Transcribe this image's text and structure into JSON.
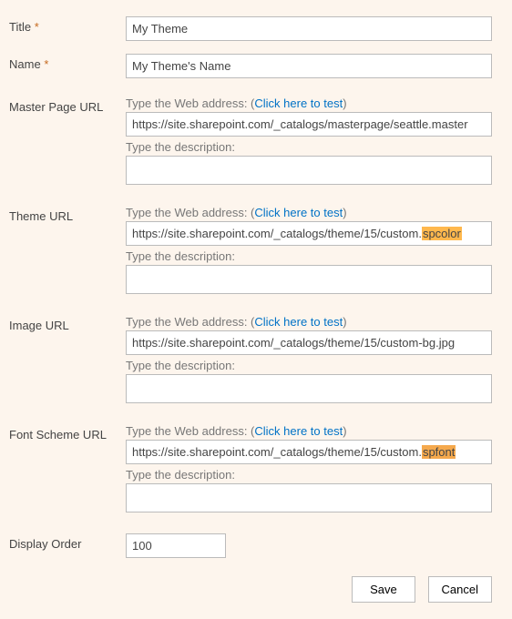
{
  "title": {
    "label": "Title",
    "req": "*",
    "value": "My Theme"
  },
  "name": {
    "label": "Name",
    "req": "*",
    "value": "My Theme's Name"
  },
  "hints": {
    "url_prefix": "Type the Web address: (",
    "url_link": "Click here to test",
    "url_suffix": ")",
    "desc": "Type the description:"
  },
  "master": {
    "label": "Master Page URL",
    "url": "https://site.sharepoint.com/_catalogs/masterpage/seattle.master",
    "desc": ""
  },
  "theme": {
    "label": "Theme URL",
    "url_pre": "https://site.sharepoint.com/_catalogs/theme/15/custom.",
    "url_hl": "spcolor",
    "desc": ""
  },
  "image": {
    "label": "Image URL",
    "url": "https://site.sharepoint.com/_catalogs/theme/15/custom-bg.jpg",
    "desc": ""
  },
  "font": {
    "label": "Font Scheme URL",
    "url_pre": "https://site.sharepoint.com/_catalogs/theme/15/custom.",
    "url_hl": "spfont",
    "desc": ""
  },
  "order": {
    "label": "Display Order",
    "value": "100"
  },
  "buttons": {
    "save": "Save",
    "cancel": "Cancel"
  }
}
